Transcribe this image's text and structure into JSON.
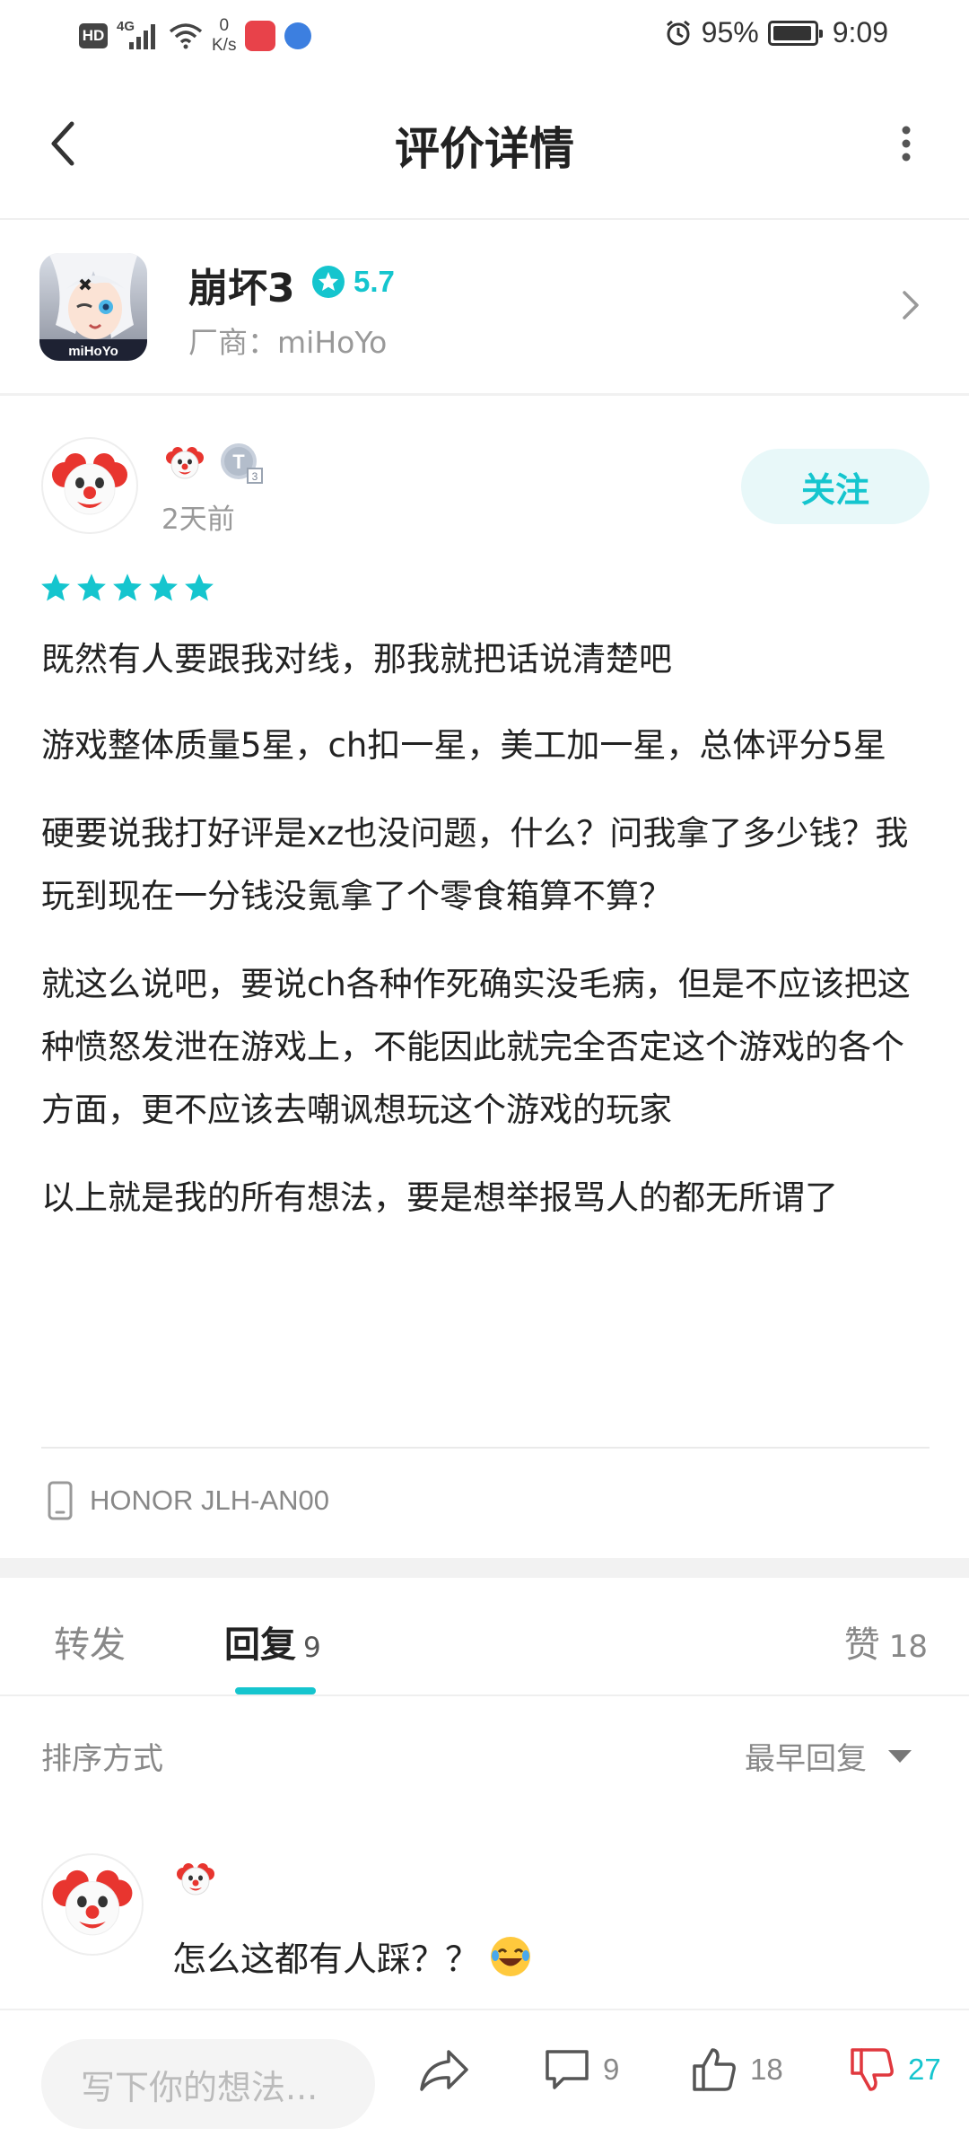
{
  "status_bar": {
    "hd": "HD",
    "net_type": "4G",
    "speed_value": "0",
    "speed_unit": "K/s",
    "battery": "95%",
    "time": "9:09"
  },
  "header": {
    "title": "评价详情"
  },
  "game": {
    "name": "崩坏3",
    "score": "5.7",
    "vendor": "厂商：miHoYo",
    "icon_text": "miHoYo"
  },
  "review": {
    "time_ago": "2天前",
    "level": "T",
    "level_num": "3",
    "follow_label": "关注",
    "stars": 5,
    "paragraphs": [
      "既然有人要跟我对线，那我就把话说清楚吧",
      "游戏整体质量5星，ch扣一星，美工加一星，总体评分5星",
      "硬要说我打好评是xz也没问题，什么？问我拿了多少钱？我玩到现在一分钱没氪拿了个零食箱算不算？",
      "就这么说吧，要说ch各种作死确实没毛病，但是不应该把这种愤怒发泄在游戏上，不能因此就完全否定这个游戏的各个方面，更不应该去嘲讽想玩这个游戏的玩家",
      "以上就是我的所有想法，要是想举报骂人的都无所谓了"
    ],
    "device": "HONOR JLH-AN00"
  },
  "tabs": {
    "forward": "转发",
    "reply": "回复",
    "reply_count": "9",
    "like": "赞",
    "like_count": "18"
  },
  "sort": {
    "label": "排序方式",
    "selected": "最早回复"
  },
  "replies": [
    {
      "text": "怎么这都有人踩？？"
    }
  ],
  "bottom_bar": {
    "input_placeholder": "写下你的想法...",
    "comment_count": "9",
    "like_count": "18",
    "dislike_count": "27"
  },
  "colors": {
    "accent": "#15c5ce",
    "dislike": "#e0383e"
  }
}
